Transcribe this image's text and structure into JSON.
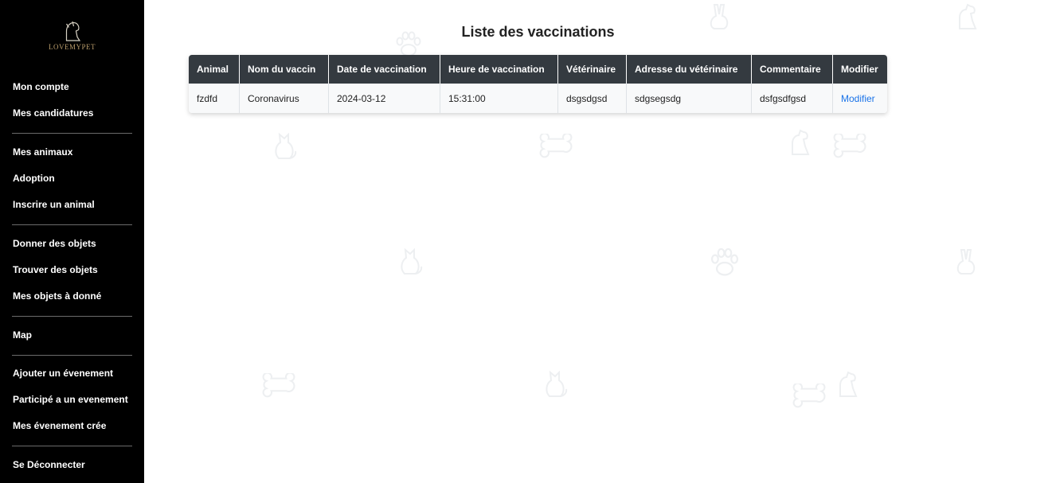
{
  "brand": {
    "name": "LOVEMYPET"
  },
  "sidebar": {
    "groups": [
      {
        "items": [
          {
            "label": "Mon compte"
          },
          {
            "label": "Mes candidatures"
          }
        ]
      },
      {
        "items": [
          {
            "label": "Mes animaux"
          },
          {
            "label": "Adoption"
          },
          {
            "label": "Inscrire un animal"
          }
        ]
      },
      {
        "items": [
          {
            "label": "Donner des objets"
          },
          {
            "label": "Trouver des objets"
          },
          {
            "label": "Mes objets à donné"
          }
        ]
      },
      {
        "items": [
          {
            "label": "Map"
          }
        ]
      },
      {
        "items": [
          {
            "label": "Ajouter un évenement"
          },
          {
            "label": "Participé a un evenement"
          },
          {
            "label": "Mes évenement crée"
          }
        ]
      },
      {
        "items": [
          {
            "label": "Se Déconnecter"
          }
        ]
      }
    ]
  },
  "page": {
    "title": "Liste des vaccinations"
  },
  "table": {
    "columns": [
      "Animal",
      "Nom du vaccin",
      "Date de vaccination",
      "Heure de vaccination",
      "Vétérinaire",
      "Adresse du vétérinaire",
      "Commentaire",
      "Modifier"
    ],
    "rows": [
      {
        "animal": "fzdfd",
        "vaccine": "Coronavirus",
        "date": "2024-03-12",
        "time": "15:31:00",
        "vet": "dsgsdgsd",
        "vet_address": "sdgsegsdg",
        "comment": "dsfgsdfgsd",
        "edit_label": "Modifier"
      }
    ]
  },
  "colors": {
    "sidebar_bg": "#000000",
    "table_header_bg": "#343a40",
    "link": "#1a73e8",
    "brand_gold": "#b89b6a"
  },
  "background_icons": [
    "dog-icon",
    "cat-icon",
    "paw-icon",
    "bone-icon",
    "rabbit-icon"
  ]
}
